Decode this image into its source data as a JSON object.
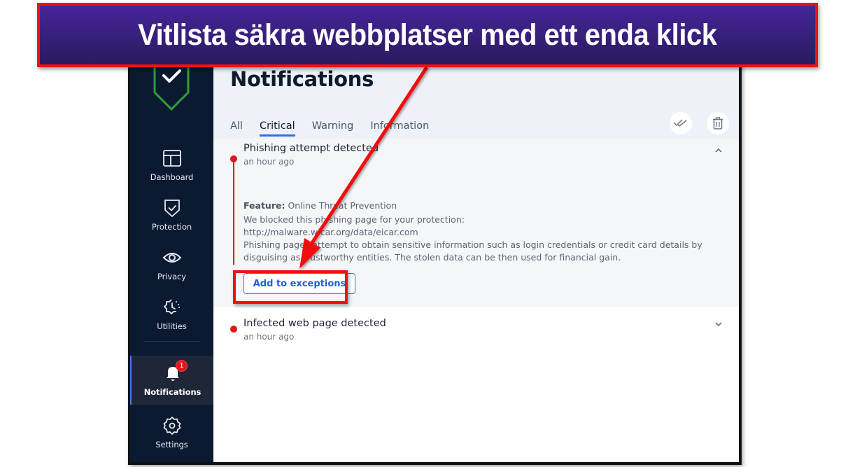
{
  "banner": {
    "text": "Vitlista säkra webbplatser med ett enda klick",
    "border_color": "#f21010",
    "bg_color": "#3a2180"
  },
  "sidebar": {
    "logo": "shield-check-logo",
    "items": [
      {
        "label": "Dashboard",
        "icon": "dashboard-icon",
        "active": false
      },
      {
        "label": "Protection",
        "icon": "shield-check-icon",
        "active": false
      },
      {
        "label": "Privacy",
        "icon": "eye-icon",
        "active": false
      },
      {
        "label": "Utilities",
        "icon": "utilities-icon",
        "active": false
      },
      {
        "label": "Notifications",
        "icon": "bell-icon",
        "active": true,
        "badge": "1"
      },
      {
        "label": "Settings",
        "icon": "gear-icon",
        "active": false
      }
    ]
  },
  "header": {
    "title": "Notifications",
    "tabs": [
      {
        "label": "All",
        "active": false
      },
      {
        "label": "Critical",
        "active": true
      },
      {
        "label": "Warning",
        "active": false
      },
      {
        "label": "Information",
        "active": false
      }
    ],
    "actions": [
      "mark-all-read-icon",
      "trash-icon"
    ]
  },
  "notifications": [
    {
      "title": "Phishing attempt detected",
      "time": "an hour ago",
      "expanded": true,
      "feature_label": "Feature:",
      "feature_value": "Online Threat Prevention",
      "body_line1": "We blocked this phishing page for your protection:",
      "body_url": "http://malware.wicar.org/data/eicar.com",
      "body_line3": "Phishing pages attempt to obtain sensitive information such as login credentials or credit card details by disguising as trustworthy entities. The stolen data can be then used for financial gain.",
      "action_label": "Add to exceptions"
    },
    {
      "title": "Infected web page detected",
      "time": "an hour ago",
      "expanded": false
    }
  ],
  "colors": {
    "sidebar_bg": "#0b1a30",
    "accent": "#2f72e6",
    "alert": "#e0161c",
    "header_bg": "#eef1f8"
  }
}
